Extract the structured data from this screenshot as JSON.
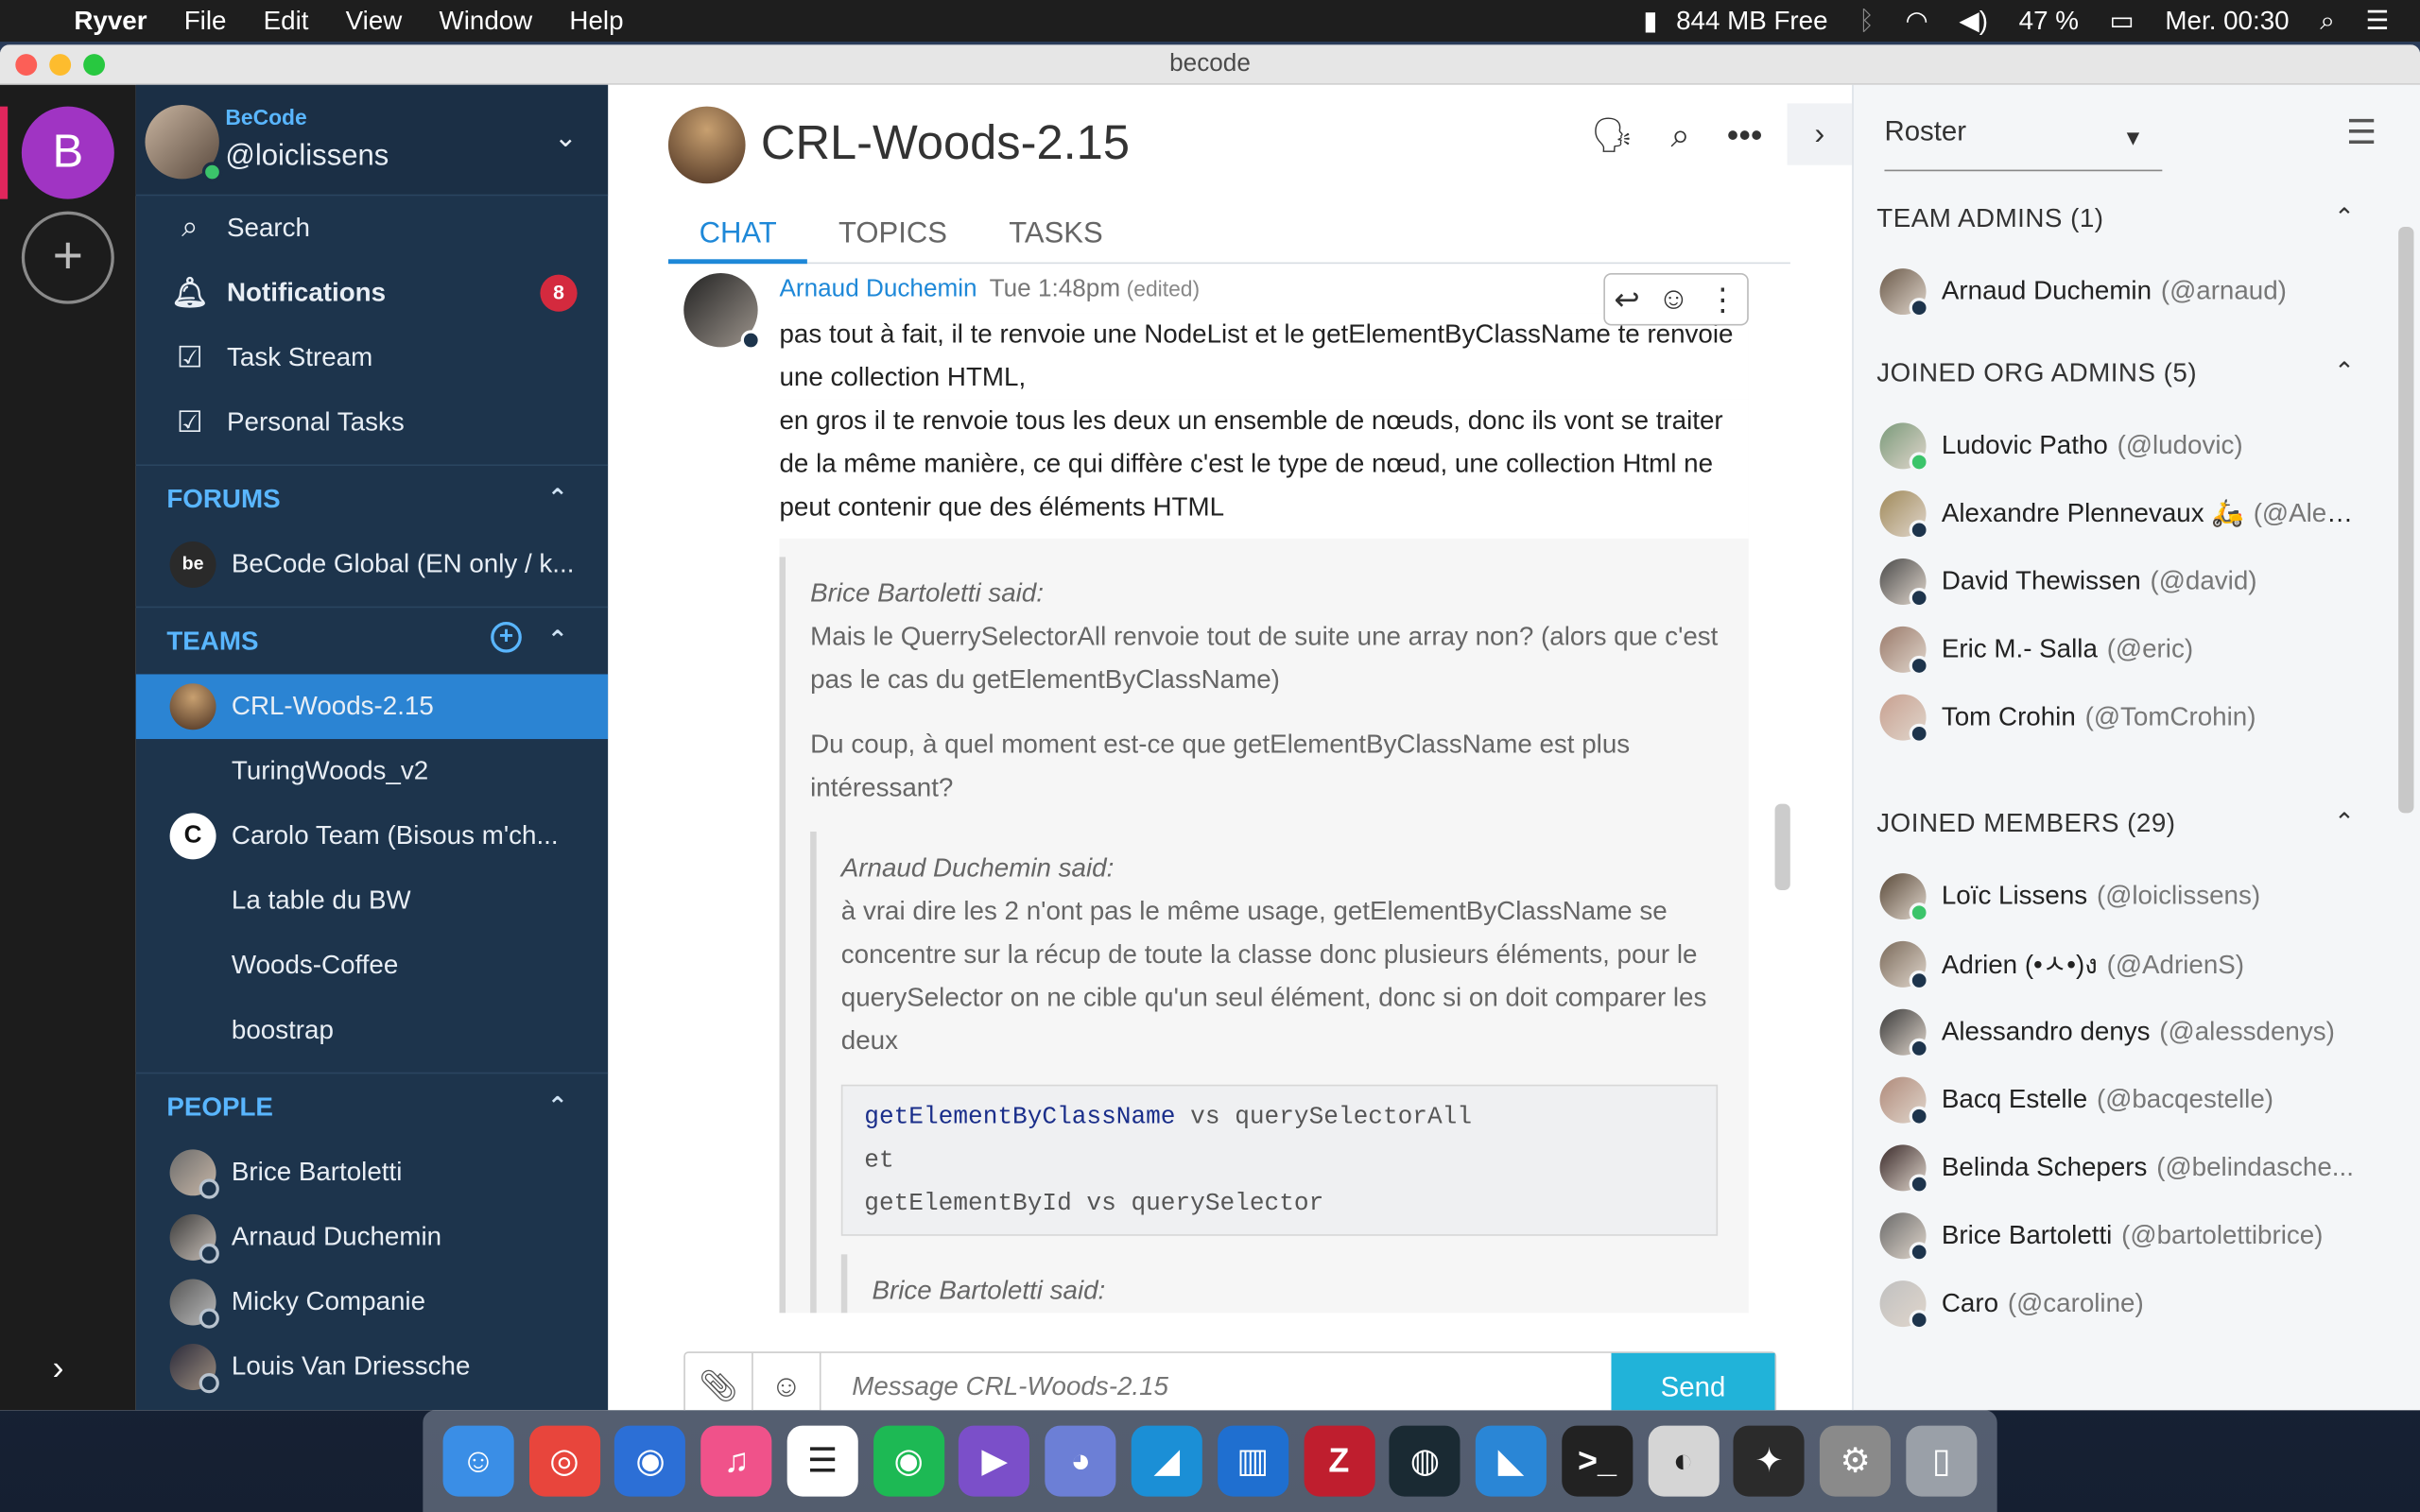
{
  "menubar": {
    "apple": "",
    "app": "Ryver",
    "items": [
      "File",
      "Edit",
      "View",
      "Window",
      "Help"
    ],
    "memory": "844 MB Free",
    "battery": "47 %",
    "clock": "Mer. 00:30"
  },
  "window": {
    "title": "becode"
  },
  "rail": {
    "workspace_initial": "B",
    "add": "+"
  },
  "sidebar": {
    "org": "BeCode",
    "handle": "@loiclissens",
    "nav": [
      {
        "label": "Search"
      },
      {
        "label": "Notifications",
        "badge": "8"
      },
      {
        "label": "Task Stream"
      },
      {
        "label": "Personal Tasks"
      }
    ],
    "forums_label": "FORUMS",
    "forums": [
      {
        "label": "BeCode Global (EN only / k...",
        "avatar_text": "be"
      }
    ],
    "teams_label": "TEAMS",
    "teams": [
      {
        "label": "CRL-Woods-2.15",
        "active": true
      },
      {
        "label": "TuringWoods_v2"
      },
      {
        "label": "Carolo Team (Bisous m'ch...",
        "avatar_text": "C"
      },
      {
        "label": "La table du BW"
      },
      {
        "label": "Woods-Coffee"
      },
      {
        "label": "boostrap"
      }
    ],
    "people_label": "PEOPLE",
    "people": [
      {
        "label": "Brice Bartoletti"
      },
      {
        "label": "Arnaud Duchemin"
      },
      {
        "label": "Micky Companie"
      },
      {
        "label": "Louis Van Driessche"
      }
    ]
  },
  "main": {
    "channel": "CRL-Woods-2.15",
    "tabs": [
      "CHAT",
      "TOPICS",
      "TASKS"
    ],
    "message": {
      "author": "Arnaud Duchemin",
      "time": "Tue 1:48pm",
      "edited": "(edited)",
      "lines": [
        "pas tout à fait, il te renvoie une NodeList et le getElementByClassName te renvoie une collection HTML,",
        "en gros il te renvoie tous les deux un ensemble de nœuds, donc ils vont se traiter de la même manière, ce qui diffère c'est le type de nœud, une collection Html ne peut contenir que des éléments HTML"
      ],
      "quote1": {
        "who": "Brice Bartoletti said:",
        "p1": "Mais le QuerrySelectorAll renvoie tout de suite une array non? (alors que c'est pas le cas du getElementByClassName)",
        "p2": "Du coup, à quel moment est-ce que getElementByClassName est plus intéressant?"
      },
      "quote2": {
        "who": "Arnaud Duchemin said:",
        "p1": "à vrai dire les 2 n'ont pas le même usage, getElementByClassName se concentre sur la récup de toute la classe donc plusieurs éléments, pour le querySelector on ne cible qu'un seul élément, donc si on doit comparer les deux"
      },
      "code": {
        "fn": "getElementByClassName",
        "line1_rest": " vs querySelectorAll",
        "line2": "et",
        "line3": "getElementById vs querySelector"
      },
      "quote3_who": "Brice Bartoletti said:"
    },
    "composer": {
      "placeholder": "Message CRL-Woods-2.15",
      "send": "Send"
    }
  },
  "roster": {
    "select": "Roster",
    "sections": [
      {
        "title": "TEAM ADMINS (1)",
        "members": [
          {
            "name": "Arnaud Duchemin",
            "handle": "(@arnaud)",
            "online": false
          }
        ]
      },
      {
        "title": "JOINED ORG ADMINS (5)",
        "members": [
          {
            "name": "Ludovic Patho",
            "handle": "(@ludovic)",
            "online": true
          },
          {
            "name": "Alexandre Plennevaux 🛵",
            "handle": "(@Alex...",
            "online": false
          },
          {
            "name": "David Thewissen",
            "handle": "(@david)",
            "online": false
          },
          {
            "name": "Eric M.- Salla",
            "handle": "(@eric)",
            "online": false
          },
          {
            "name": "Tom Crohin",
            "handle": "(@TomCrohin)",
            "online": false
          }
        ]
      },
      {
        "title": "JOINED MEMBERS (29)",
        "members": [
          {
            "name": "Loïc Lissens",
            "handle": "(@loiclissens)",
            "online": true
          },
          {
            "name": "Adrien (•ㅅ•)ง",
            "handle": "(@AdrienS)",
            "online": false
          },
          {
            "name": "Alessandro denys",
            "handle": "(@alessdenys)",
            "online": false
          },
          {
            "name": "Bacq Estelle",
            "handle": "(@bacqestelle)",
            "online": false
          },
          {
            "name": "Belinda Schepers",
            "handle": "(@belindasche...",
            "online": false
          },
          {
            "name": "Brice Bartoletti",
            "handle": "(@bartolettibrice)",
            "online": false
          },
          {
            "name": "Caro",
            "handle": "(@caroline)",
            "online": false
          }
        ]
      }
    ]
  },
  "dock": {
    "apps": [
      {
        "icon": "finder-icon",
        "color": "#3a8ee6"
      },
      {
        "icon": "chrome-icon",
        "color": "#e8453c"
      },
      {
        "icon": "firefox-icon",
        "color": "#2c6fd6"
      },
      {
        "icon": "itunes-icon",
        "color": "#f0528a"
      },
      {
        "icon": "toolbox-icon",
        "color": "#ffffff"
      },
      {
        "icon": "spotify-icon",
        "color": "#1db954"
      },
      {
        "icon": "vectorize-icon",
        "color": "#7b4fc9"
      },
      {
        "icon": "discord-icon",
        "color": "#6c7fd6"
      },
      {
        "icon": "kite-icon",
        "color": "#1b8fd6"
      },
      {
        "icon": "trello-icon",
        "color": "#1f6fd0"
      },
      {
        "icon": "filezilla-icon",
        "color": "#bf1e2e"
      },
      {
        "icon": "gitkraken-icon",
        "color": "#1a2a33"
      },
      {
        "icon": "vscode-icon",
        "color": "#2a86d6"
      },
      {
        "icon": "terminal-icon",
        "color": "#222222"
      },
      {
        "icon": "tableplus-icon",
        "color": "#d5d5d5"
      },
      {
        "icon": "figma-icon",
        "color": "#2b2b2b"
      },
      {
        "icon": "system-preferences-icon",
        "color": "#8a8a8a"
      },
      {
        "icon": "trash-icon",
        "color": "#9aa0a8"
      }
    ]
  }
}
